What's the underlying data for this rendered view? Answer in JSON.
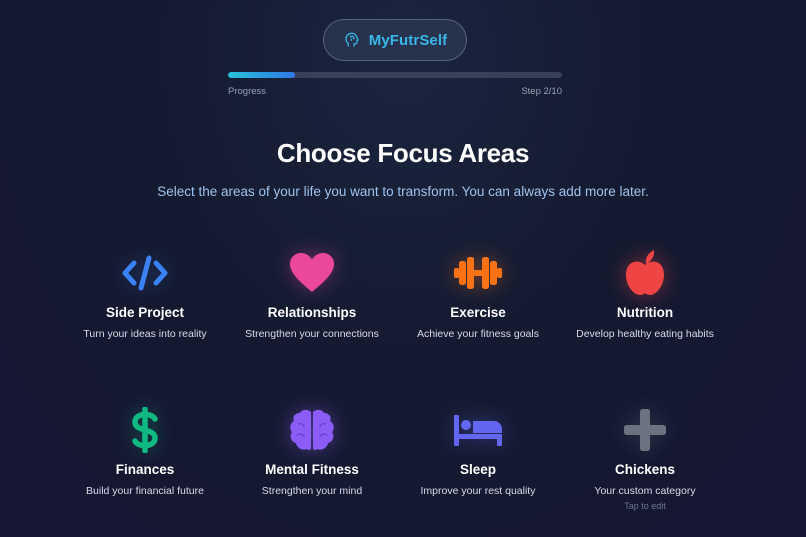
{
  "app": {
    "name": "MyFutrSelf",
    "logo_icon": "head-profile-icon"
  },
  "progress": {
    "label": "Progress",
    "step_text": "Step 2/10",
    "fraction": 0.2
  },
  "page": {
    "title": "Choose Focus Areas",
    "subtitle": "Select the areas of your life you want to transform. You can always add more later."
  },
  "focus_areas": [
    {
      "title": "Side Project",
      "description": "Turn your ideas into reality",
      "icon": "code-icon",
      "color": "#3b82f6"
    },
    {
      "title": "Relationships",
      "description": "Strengthen your connections",
      "icon": "heart-icon",
      "color": "#ec4899"
    },
    {
      "title": "Exercise",
      "description": "Achieve your fitness goals",
      "icon": "dumbbell-icon",
      "color": "#f97316"
    },
    {
      "title": "Nutrition",
      "description": "Develop healthy eating habits",
      "icon": "apple-icon",
      "color": "#ef4444"
    },
    {
      "title": "Finances",
      "description": "Build your financial future",
      "icon": "dollar-icon",
      "color": "#10b981"
    },
    {
      "title": "Mental Fitness",
      "description": "Strengthen your mind",
      "icon": "brain-icon",
      "color": "#8b5cf6"
    },
    {
      "title": "Sleep",
      "description": "Improve your rest quality",
      "icon": "bed-icon",
      "color": "#6366f1"
    },
    {
      "title": "Chickens",
      "description": "Your custom category",
      "hint": "Tap to edit",
      "icon": "plus-icon",
      "color": "#6b7280"
    }
  ]
}
